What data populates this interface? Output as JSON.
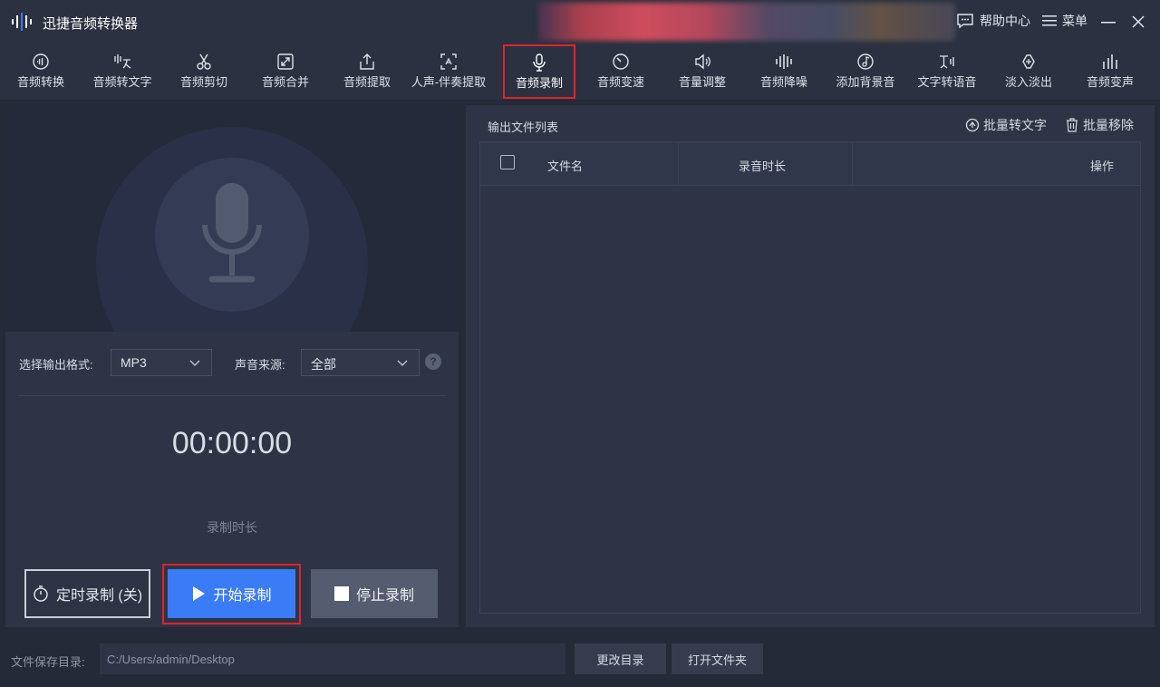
{
  "app": {
    "title": "迅捷音频转换器",
    "help_label": "帮助中心",
    "menu_label": "菜单"
  },
  "toolbar": {
    "items": [
      {
        "label": "音频转换",
        "icon": "audio-convert-icon"
      },
      {
        "label": "音频转文字",
        "icon": "speech-to-text-icon"
      },
      {
        "label": "音频剪切",
        "icon": "scissors-icon"
      },
      {
        "label": "音频合并",
        "icon": "merge-icon"
      },
      {
        "label": "音频提取",
        "icon": "extract-icon"
      },
      {
        "label": "人声-伴奏提取",
        "icon": "vocal-extract-icon"
      },
      {
        "label": "音频录制",
        "icon": "microphone-icon",
        "active": true
      },
      {
        "label": "音频变速",
        "icon": "speed-icon"
      },
      {
        "label": "音量调整",
        "icon": "volume-icon"
      },
      {
        "label": "音频降噪",
        "icon": "denoise-icon"
      },
      {
        "label": "添加背景音",
        "icon": "music-note-icon"
      },
      {
        "label": "文字转语音",
        "icon": "text-to-speech-icon"
      },
      {
        "label": "淡入淡出",
        "icon": "fade-icon"
      },
      {
        "label": "音频变声",
        "icon": "voice-change-icon"
      }
    ]
  },
  "recorder": {
    "format_label": "选择输出格式:",
    "format_value": "MP3",
    "source_label": "声音来源:",
    "source_value": "全部",
    "help": "?",
    "timer": "00:00:00",
    "timer_caption": "录制时长",
    "timed_record_label": "定时录制 (关)",
    "start_label": "开始录制",
    "stop_label": "停止录制"
  },
  "output": {
    "title": "输出文件列表",
    "batch_text_label": "批量转文字",
    "batch_remove_label": "批量移除",
    "columns": [
      "文件名",
      "录音时长",
      "操作"
    ],
    "rows": []
  },
  "footer": {
    "dir_label": "文件保存目录:",
    "dir_value": "C:/Users/admin/Desktop",
    "change_dir_label": "更改目录",
    "open_folder_label": "打开文件夹"
  },
  "colors": {
    "accent": "#3a7bf6",
    "highlight": "#e0232d",
    "background": "#252a38"
  }
}
